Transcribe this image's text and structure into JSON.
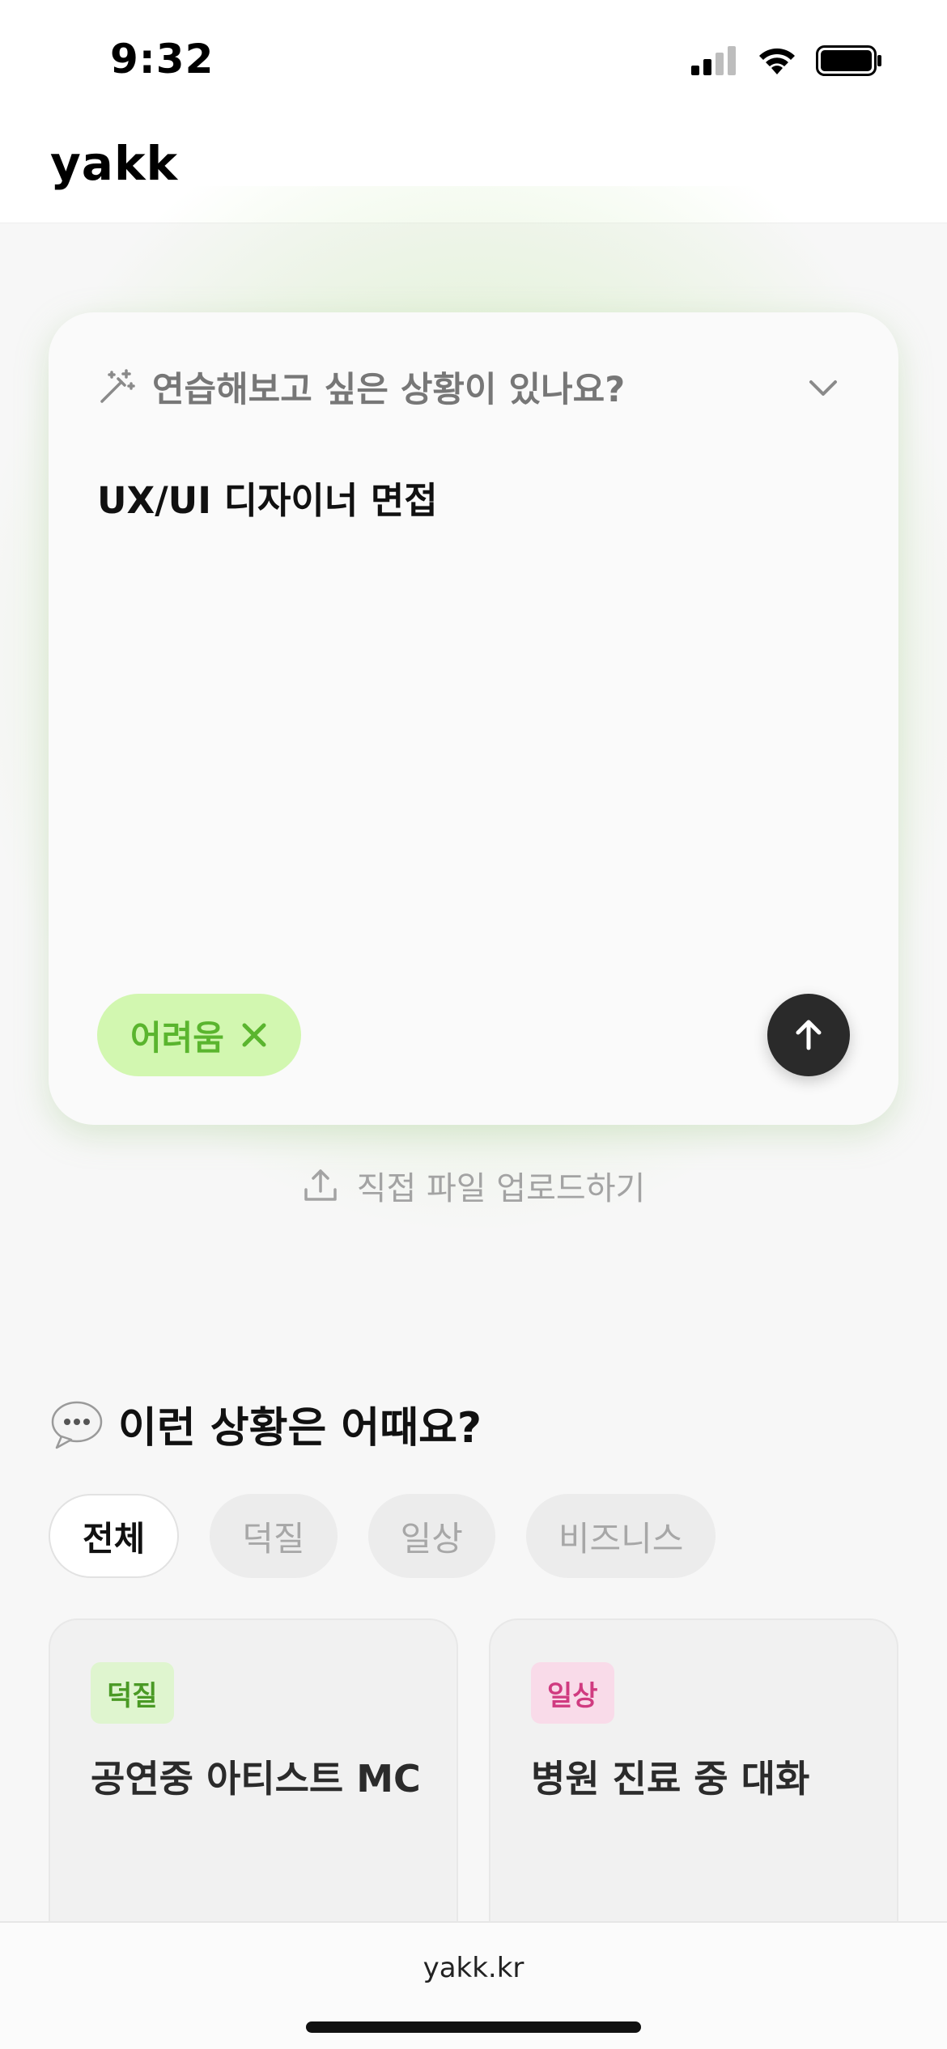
{
  "status_bar": {
    "time": "9:32"
  },
  "header": {
    "logo": "yakk"
  },
  "composer": {
    "prompt_icon": "magic-wand-icon",
    "prompt_title": "연습해보고 싶은 상황이 있나요?",
    "scenario_text": "UX/UI 디자이너 면접",
    "difficulty_label": "어려움",
    "accent_color": "#5ab52e",
    "submit_icon": "arrow-up-icon"
  },
  "upload": {
    "label": "직접 파일 업로드하기",
    "icon": "upload-icon"
  },
  "suggestions": {
    "title_icon": "💬",
    "title": "이런 상황은 어때요?",
    "filters": [
      {
        "label": "전체",
        "active": true
      },
      {
        "label": "덕질",
        "active": false
      },
      {
        "label": "일상",
        "active": false
      },
      {
        "label": "비즈니스",
        "active": false
      }
    ],
    "cards": [
      {
        "tag": "덕질",
        "tag_color": "#4a9a25",
        "title": "공연중 아티스트 MC"
      },
      {
        "tag": "일상",
        "tag_color": "#d03b80",
        "title": "병원 진료 중 대화"
      }
    ]
  },
  "browser": {
    "url": "yakk.kr"
  }
}
